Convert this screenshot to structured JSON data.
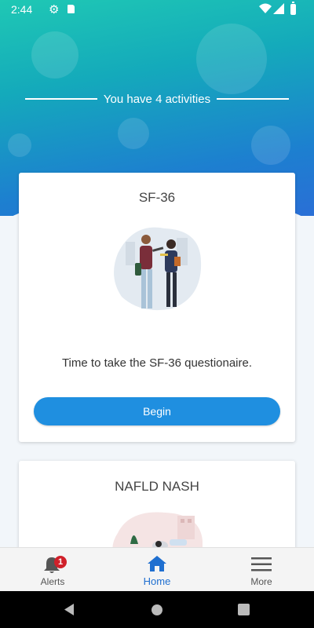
{
  "status_bar": {
    "time": "2:44",
    "icons": [
      "gear-icon",
      "sd-card-icon",
      "wifi-icon",
      "signal-icon",
      "battery-icon"
    ]
  },
  "header": {
    "activity_count_text": "You have 4 activities"
  },
  "cards": [
    {
      "title": "SF-36",
      "description": "Time to take the SF-36 questionaire.",
      "button_label": "Begin",
      "illustration": "two-people-with-tablet-illustration"
    },
    {
      "title": "NAFLD NASH",
      "illustration": "doctor-consultation-illustration"
    }
  ],
  "bottom_nav": {
    "items": [
      {
        "label": "Alerts",
        "icon": "bell-icon",
        "badge": "1"
      },
      {
        "label": "Home",
        "icon": "home-icon",
        "active": true
      },
      {
        "label": "More",
        "icon": "hamburger-icon"
      }
    ]
  },
  "colors": {
    "accent": "#1f8fe0",
    "nav_active": "#1f6fd0",
    "badge": "#d0202a"
  }
}
